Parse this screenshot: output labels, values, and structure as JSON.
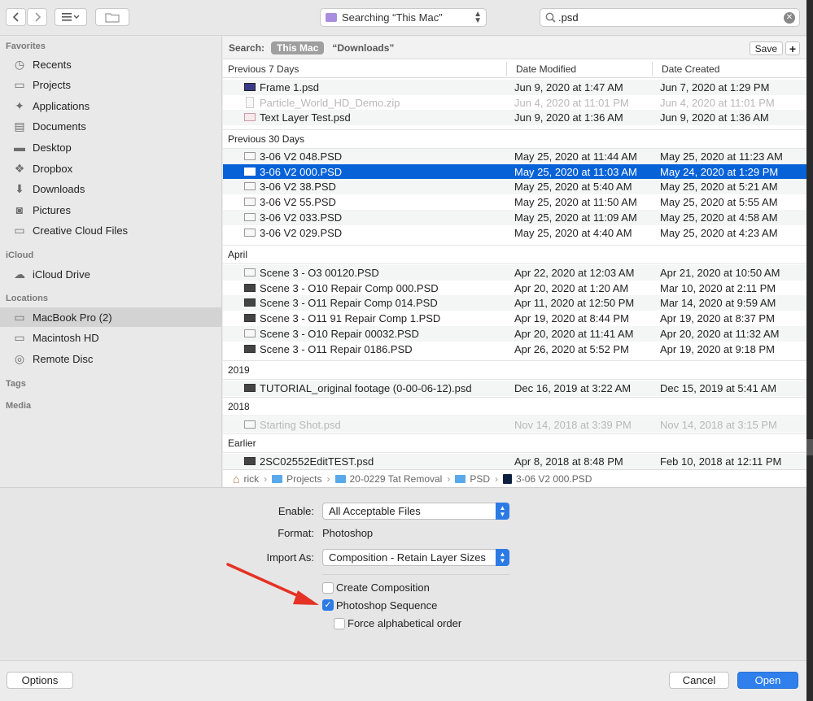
{
  "toolbar": {
    "search_scope": "Searching “This Mac”",
    "search_query": ".psd"
  },
  "sidebar": {
    "favorites_header": "Favorites",
    "favorites": [
      {
        "label": "Recents",
        "icon": "clock-icon"
      },
      {
        "label": "Projects",
        "icon": "folder-icon"
      },
      {
        "label": "Applications",
        "icon": "applications-icon"
      },
      {
        "label": "Documents",
        "icon": "documents-icon"
      },
      {
        "label": "Desktop",
        "icon": "desktop-icon"
      },
      {
        "label": "Dropbox",
        "icon": "dropbox-icon"
      },
      {
        "label": "Downloads",
        "icon": "downloads-icon"
      },
      {
        "label": "Pictures",
        "icon": "pictures-icon"
      },
      {
        "label": "Creative Cloud Files",
        "icon": "folder-icon"
      }
    ],
    "icloud_header": "iCloud",
    "icloud": [
      {
        "label": "iCloud Drive",
        "icon": "cloud-icon"
      }
    ],
    "locations_header": "Locations",
    "locations": [
      {
        "label": "MacBook Pro (2)",
        "icon": "laptop-icon"
      },
      {
        "label": "Macintosh HD",
        "icon": "disk-icon"
      },
      {
        "label": "Remote Disc",
        "icon": "disc-icon"
      }
    ],
    "tags_header": "Tags",
    "media_header": "Media"
  },
  "searchbar": {
    "label": "Search:",
    "scope_active": "This Mac",
    "scope_other": "“Downloads”",
    "save_label": "Save",
    "add_label": "+"
  },
  "columns": {
    "name": "Previous 7 Days",
    "modified": "Date Modified",
    "created": "Date Created"
  },
  "groups": [
    {
      "title": "Previous 7 Days",
      "rows": [
        {
          "name": "Frame 1.psd",
          "modified": "Jun 9, 2020 at 1:47 AM",
          "created": "Jun 7, 2020 at 1:29 PM",
          "icon": "purple"
        },
        {
          "name": "Particle_World_HD_Demo.zip",
          "modified": "Jun 4, 2020 at 11:01 PM",
          "created": "Jun 4, 2020 at 11:01 PM",
          "icon": "zip",
          "dim": true
        },
        {
          "name": "Text Layer Test.psd",
          "modified": "Jun 9, 2020 at 1:36 AM",
          "created": "Jun 9, 2020 at 1:36 AM",
          "icon": "pink"
        }
      ]
    },
    {
      "title": "Previous 30 Days",
      "rows": [
        {
          "name": "3-06 V2 048.PSD",
          "modified": "May 25, 2020 at 11:44 AM",
          "created": "May 25, 2020 at 11:23 AM",
          "icon": "light"
        },
        {
          "name": "3-06 V2 000.PSD",
          "modified": "May 25, 2020 at 11:03 AM",
          "created": "May 24, 2020 at 1:29 PM",
          "icon": "light",
          "selected": true
        },
        {
          "name": "3-06 V2 38.PSD",
          "modified": "May 25, 2020 at 5:40 AM",
          "created": "May 25, 2020 at 5:21 AM",
          "icon": "light"
        },
        {
          "name": "3-06 V2 55.PSD",
          "modified": "May 25, 2020 at 11:50 AM",
          "created": "May 25, 2020 at 5:55 AM",
          "icon": "light"
        },
        {
          "name": "3-06 V2 033.PSD",
          "modified": "May 25, 2020 at 11:09 AM",
          "created": "May 25, 2020 at 4:58 AM",
          "icon": "light"
        },
        {
          "name": "3-06 V2 029.PSD",
          "modified": "May 25, 2020 at 4:40 AM",
          "created": "May 25, 2020 at 4:23 AM",
          "icon": "light"
        }
      ]
    },
    {
      "title": "April",
      "rows": [
        {
          "name": "Scene 3 - O3 00120.PSD",
          "modified": "Apr 22, 2020 at 12:03 AM",
          "created": "Apr 21, 2020 at 10:50 AM",
          "icon": "light"
        },
        {
          "name": "Scene 3 - O10 Repair Comp 000.PSD",
          "modified": "Apr 20, 2020 at 1:20 AM",
          "created": "Mar 10, 2020 at 2:11 PM",
          "icon": "dark"
        },
        {
          "name": "Scene 3 - O11 Repair Comp 014.PSD",
          "modified": "Apr 11, 2020 at 12:50 PM",
          "created": "Mar 14, 2020 at 9:59 AM",
          "icon": "dark"
        },
        {
          "name": "Scene 3 - O11 91 Repair Comp 1.PSD",
          "modified": "Apr 19, 2020 at 8:44 PM",
          "created": "Apr 19, 2020 at 8:37 PM",
          "icon": "dark"
        },
        {
          "name": "Scene 3 - O10 Repair 00032.PSD",
          "modified": "Apr 20, 2020 at 11:41 AM",
          "created": "Apr 20, 2020 at 11:32 AM",
          "icon": "light"
        },
        {
          "name": "Scene 3 - O11 Repair 0186.PSD",
          "modified": "Apr 26, 2020 at 5:52 PM",
          "created": "Apr 19, 2020 at 9:18 PM",
          "icon": "dark"
        }
      ]
    },
    {
      "title": "2019",
      "rows": [
        {
          "name": "TUTORIAL_original footage (0-00-06-12).psd",
          "modified": "Dec 16, 2019 at 3:22 AM",
          "created": "Dec 15, 2019 at 5:41 AM",
          "icon": "dark"
        }
      ]
    },
    {
      "title": "2018",
      "rows": [
        {
          "name": "Starting Shot.psd",
          "modified": "Nov 14, 2018 at 3:39 PM",
          "created": "Nov 14, 2018 at 3:15 PM",
          "icon": "light",
          "dim": true
        }
      ]
    },
    {
      "title": "Earlier",
      "rows": [
        {
          "name": "2SC02552EditTEST.psd",
          "modified": "Apr 8, 2018 at 8:48 PM",
          "created": "Feb 10, 2018 at 12:11 PM",
          "icon": "dark"
        }
      ]
    }
  ],
  "pathbar": [
    {
      "label": "rick",
      "icon": "home-icon"
    },
    {
      "label": "Projects",
      "icon": "folder-icon"
    },
    {
      "label": "20-0229 Tat Removal",
      "icon": "folder-icon"
    },
    {
      "label": "PSD",
      "icon": "folder-icon"
    },
    {
      "label": "3-06 V2 000.PSD",
      "icon": "psd-file-icon"
    }
  ],
  "options": {
    "enable_label": "Enable:",
    "enable_value": "All Acceptable Files",
    "format_label": "Format:",
    "format_value": "Photoshop",
    "import_label": "Import As:",
    "import_value": "Composition - Retain Layer Sizes",
    "create_composition": {
      "label": "Create Composition",
      "checked": false
    },
    "photoshop_sequence": {
      "label": "Photoshop Sequence",
      "checked": true
    },
    "force_alpha": {
      "label": "Force alphabetical order",
      "checked": false
    }
  },
  "buttons": {
    "options": "Options",
    "cancel": "Cancel",
    "open": "Open"
  },
  "colors": {
    "selection": "#0762d8",
    "accent": "#2f80ed",
    "annotation_arrow": "#e53224"
  }
}
